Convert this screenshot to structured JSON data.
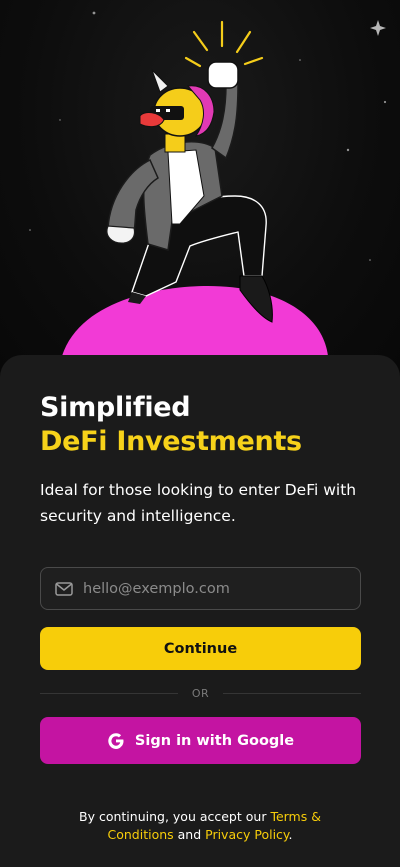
{
  "colors": {
    "background": "#0b0b0b",
    "sheet": "#1b1b1b",
    "accent_yellow": "#f7cd0a",
    "accent_magenta": "#c414a2",
    "planet_pink": "#f23ad6"
  },
  "hero": {
    "illustration": "unicorn-duck-dancing-on-planet",
    "icons": [
      "star-sparkle",
      "raised-fist",
      "sunglasses",
      "unicorn-horn"
    ]
  },
  "headline": {
    "line1": "Simplified",
    "line2": "DeFi Investments"
  },
  "subtitle": "Ideal for those looking to enter DeFi with security and intelligence.",
  "email": {
    "placeholder": "hello@exemplo.com",
    "value": "",
    "icon": "mail-icon"
  },
  "continue_label": "Continue",
  "divider_label": "OR",
  "google": {
    "label": "Sign in with Google",
    "icon": "google-icon"
  },
  "legal": {
    "prefix": "By continuing, you accept our ",
    "terms": "Terms & Conditions",
    "and": " and ",
    "privacy": "Privacy Policy",
    "suffix": "."
  }
}
